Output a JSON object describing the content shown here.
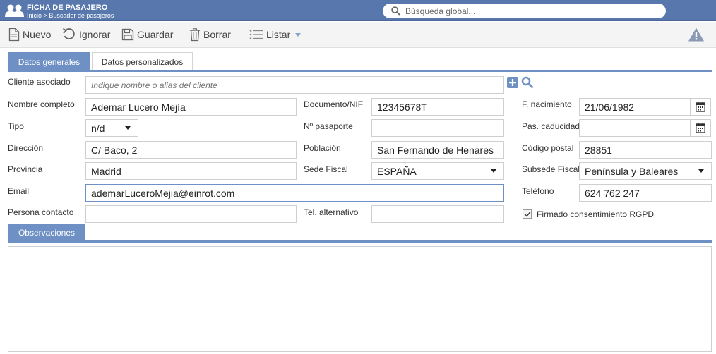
{
  "header": {
    "title": "FICHA DE PASAJERO",
    "breadcrumb_home": "Inicio",
    "breadcrumb_sep": ">",
    "breadcrumb_current": "Buscador de pasajeros",
    "global_search_placeholder": "Búsqueda global..."
  },
  "toolbar": {
    "new_label": "Nuevo",
    "ignore_label": "Ignorar",
    "save_label": "Guardar",
    "delete_label": "Borrar",
    "list_label": "Listar"
  },
  "tabs": [
    {
      "label": "Datos generales",
      "active": true
    },
    {
      "label": "Datos personalizados",
      "active": false
    }
  ],
  "form": {
    "cliente_asociado": {
      "label": "Cliente asociado",
      "placeholder": "Indique nombre o alias del cliente",
      "value": ""
    },
    "nombre_completo": {
      "label": "Nombre completo",
      "value": "Ademar Lucero Mejía"
    },
    "documento": {
      "label": "Documento/NIF",
      "value": "12345678T"
    },
    "f_nacimiento": {
      "label": "F. nacimiento",
      "value": "21/06/1982"
    },
    "tipo": {
      "label": "Tipo",
      "value": "n/d"
    },
    "pasaporte": {
      "label": "Nº pasaporte",
      "value": ""
    },
    "pas_caducidad": {
      "label": "Pas. caducidad",
      "value": ""
    },
    "direccion": {
      "label": "Dirección",
      "value": "C/ Baco, 2"
    },
    "poblacion": {
      "label": "Población",
      "value": "San Fernando de Henares"
    },
    "codigo_postal": {
      "label": "Código postal",
      "value": "28851"
    },
    "provincia": {
      "label": "Provincia",
      "value": "Madrid"
    },
    "sede_fiscal": {
      "label": "Sede Fiscal",
      "value": "ESPAÑA"
    },
    "subsede_fiscal": {
      "label": "Subsede Fiscal",
      "value": "Península y Baleares"
    },
    "email": {
      "label": "Email",
      "value": "ademarLuceroMejia@einrot.com"
    },
    "telefono": {
      "label": "Teléfono",
      "value": "624 762 247"
    },
    "persona_contacto": {
      "label": "Persona contacto",
      "value": ""
    },
    "tel_alternativo": {
      "label": "Tel. alternativo",
      "value": ""
    },
    "rgpd": {
      "label": "Firmado consentimiento RGPD",
      "checked": true
    }
  },
  "observaciones": {
    "tab_label": "Observaciones",
    "value": ""
  },
  "colors": {
    "header_bg": "#5878ad",
    "accent": "#6e90c4",
    "warning": "#8a9ab5"
  }
}
